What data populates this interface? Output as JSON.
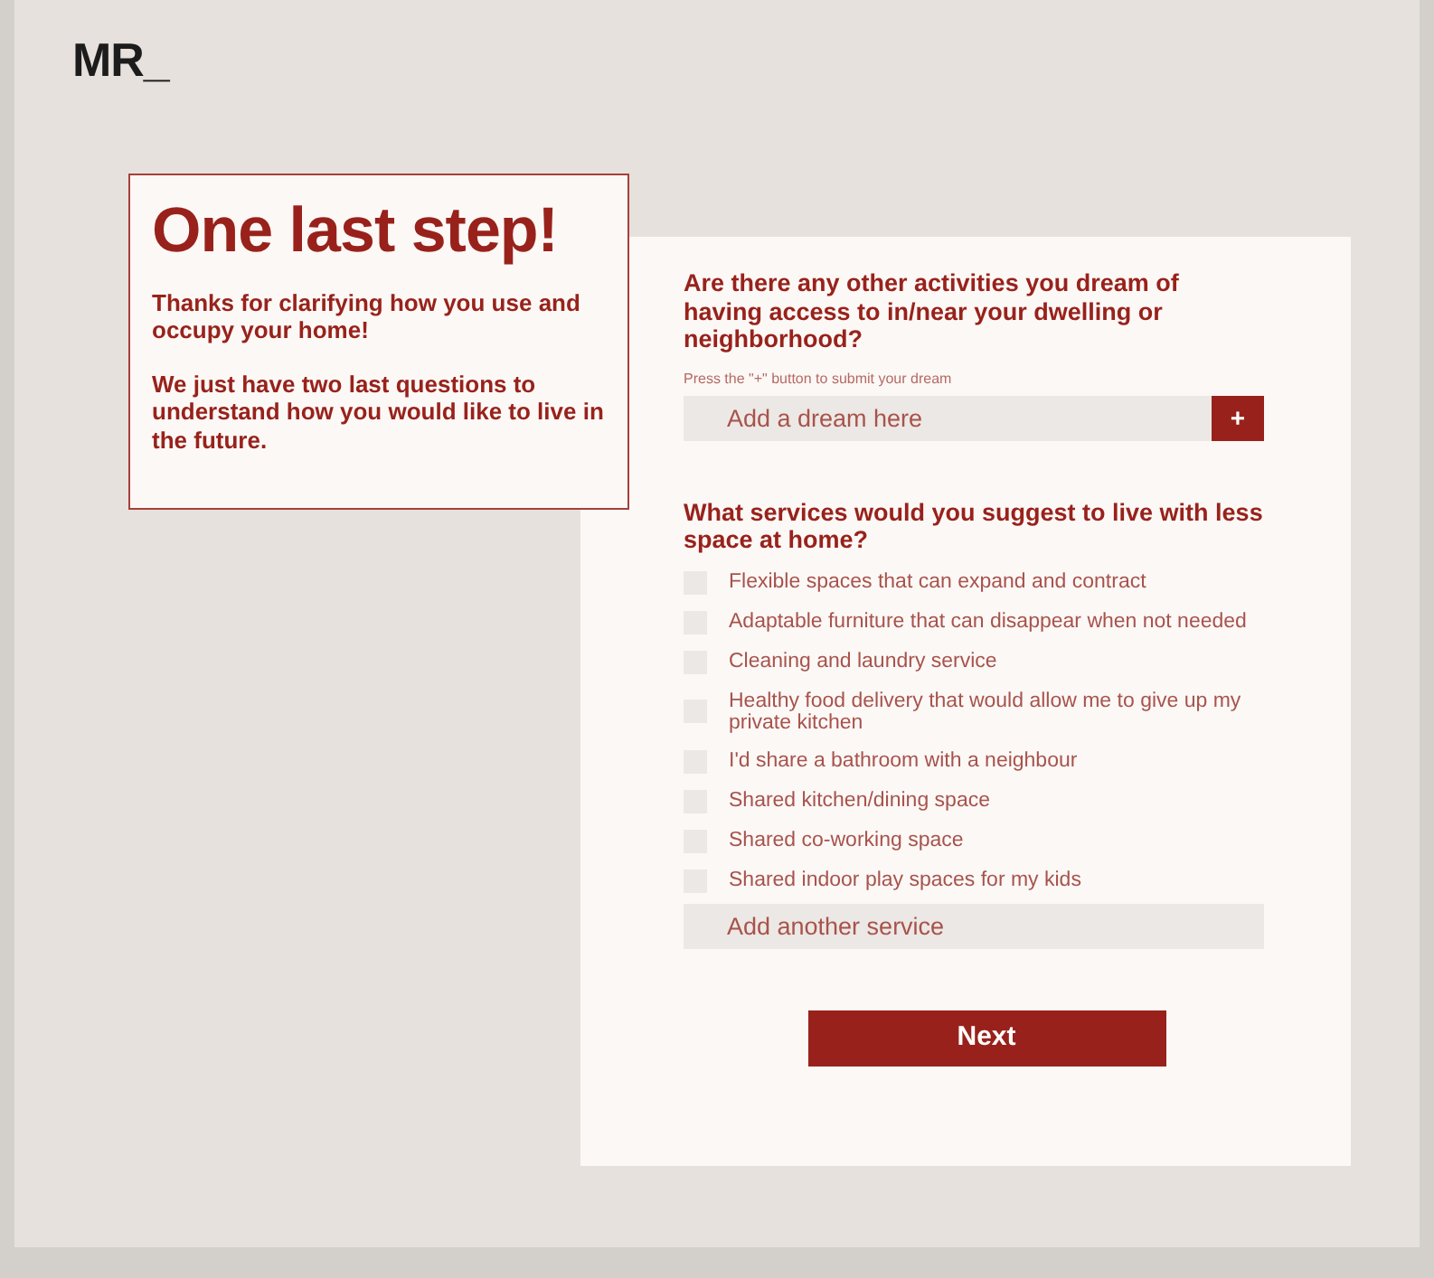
{
  "logo": "MR_",
  "intro": {
    "title": "One last step!",
    "paragraphs": [
      "Thanks for clarifying how you use and occupy your home!",
      "We just have two last questions to understand how you would like to live in the future."
    ]
  },
  "dream_question": {
    "title": "Are there any other activities you dream of having access to in/near your dwelling or neighborhood?",
    "hint": "Press the \"+\" button to submit your dream",
    "placeholder": "Add a dream here",
    "add_button": "+"
  },
  "services_question": {
    "title": "What services would you suggest to live with less space at home?",
    "options": [
      {
        "label": "Flexible spaces that can expand and contract",
        "checked": false
      },
      {
        "label": "Adaptable furniture that can disappear when not needed",
        "checked": false
      },
      {
        "label": "Cleaning and laundry service",
        "checked": false
      },
      {
        "label": "Healthy food delivery that would allow me to give up my private kitchen",
        "checked": false
      },
      {
        "label": "I'd share a bathroom with a neighbour",
        "checked": false
      },
      {
        "label": "Shared kitchen/dining space",
        "checked": false
      },
      {
        "label": "Shared co-working space",
        "checked": false
      },
      {
        "label": "Shared indoor play spaces for my kids",
        "checked": false
      }
    ],
    "other_placeholder": "Add another service"
  },
  "next_button": "Next"
}
